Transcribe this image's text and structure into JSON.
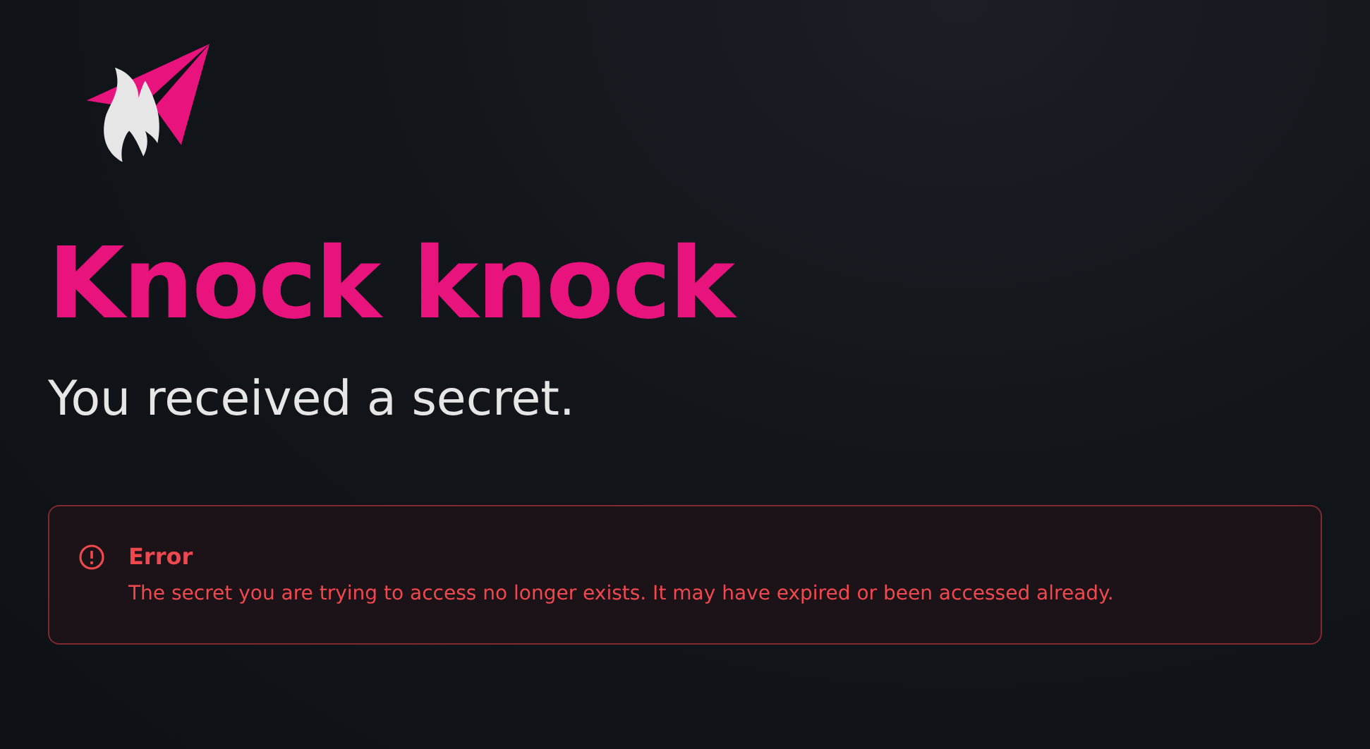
{
  "heading": "Knock knock",
  "subheading": "You received a secret.",
  "alert": {
    "kind": "error",
    "title": "Error",
    "message": "The secret you are trying to access no longer exists. It may have expired or been accessed already."
  }
}
